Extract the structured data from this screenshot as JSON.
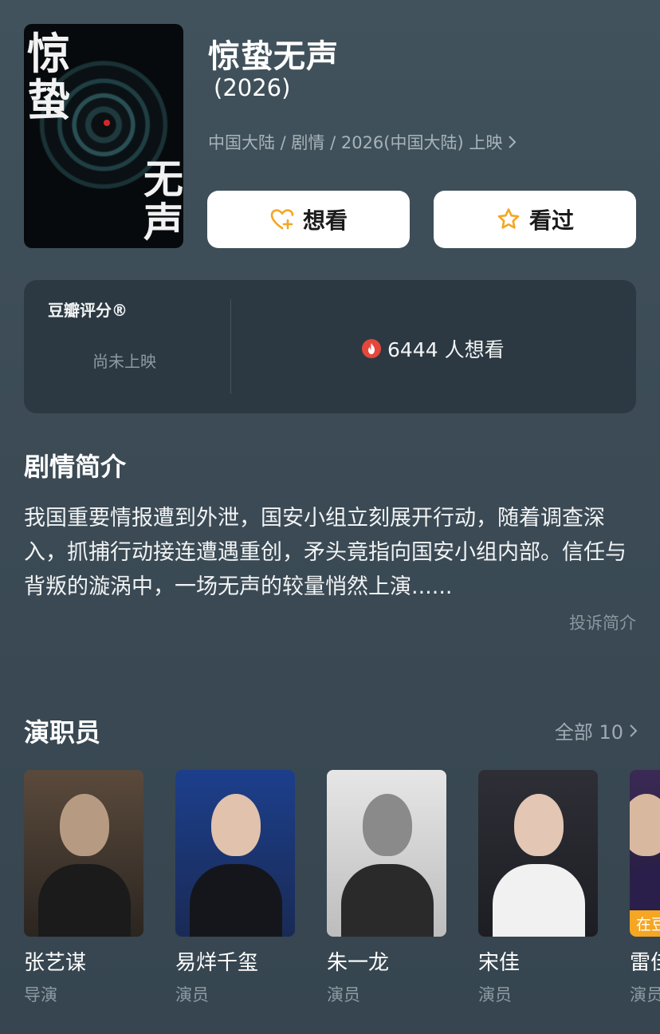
{
  "movie": {
    "title": "惊蛰无声",
    "year": "(2026)",
    "meta": "中国大陆 / 剧情 / 2026(中国大陆) 上映",
    "poster_text_1": "惊蛰",
    "poster_text_2": "无声"
  },
  "actions": {
    "want_label": "想看",
    "seen_label": "看过"
  },
  "rating": {
    "label": "豆瓣评分®",
    "status": "尚未上映",
    "want_count": "6444 人想看"
  },
  "synopsis": {
    "title": "剧情简介",
    "text": "我国重要情报遭到外泄，国安小组立刻展开行动，随着调查深入，抓捕行动接连遭遇重创，矛头竟指向国安小组内部。信任与背叛的漩涡中，一场无声的较量悄然上演......",
    "report": "投诉简介"
  },
  "cast": {
    "title": "演职员",
    "all": "全部 10",
    "members": [
      {
        "name": "张艺谋",
        "role": "导演"
      },
      {
        "name": "易烊千玺",
        "role": "演员"
      },
      {
        "name": "朱一龙",
        "role": "演员"
      },
      {
        "name": "宋佳",
        "role": "演员"
      },
      {
        "name": "雷佳",
        "role": "演员",
        "badge": "在豆"
      }
    ]
  },
  "colors": {
    "accent_orange": "#f5a623",
    "fire_red": "#e4473b"
  }
}
